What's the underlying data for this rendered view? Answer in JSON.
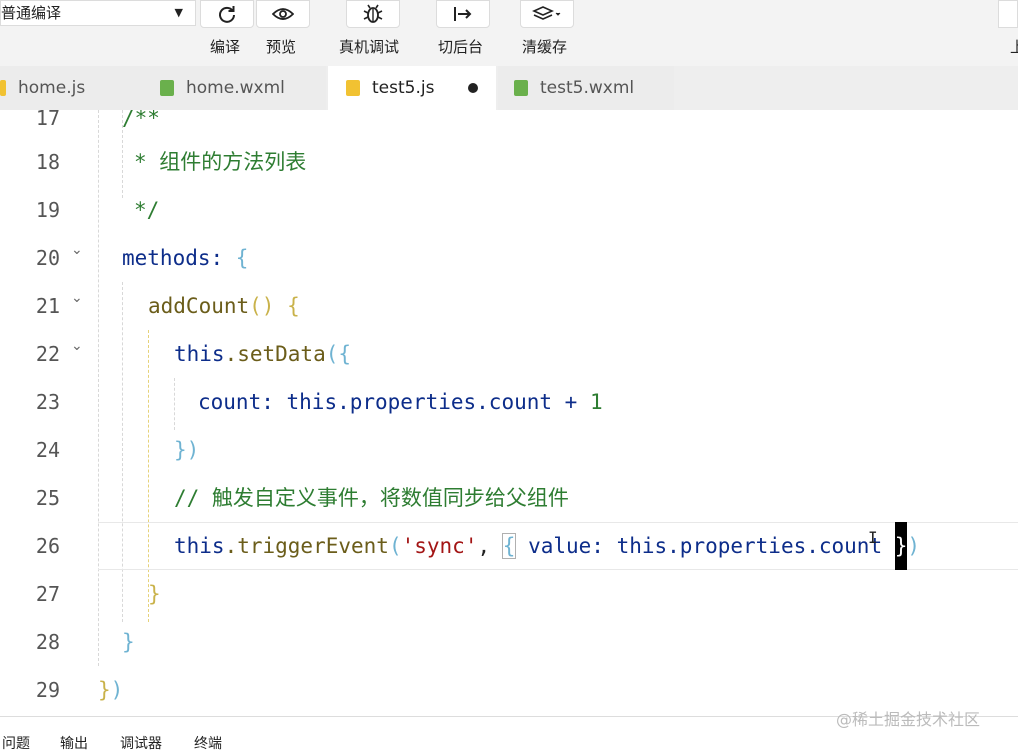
{
  "toolbar": {
    "mode_select": "普通编译",
    "buttons": [
      {
        "icon": "refresh-icon",
        "label": "编译"
      },
      {
        "icon": "eye-icon",
        "label": "预览"
      },
      {
        "icon": "bug-icon",
        "label": "真机调试"
      },
      {
        "icon": "switch-backend-icon",
        "label": "切后台"
      },
      {
        "icon": "layers-icon",
        "label": "清缓存"
      }
    ],
    "right_label": "上"
  },
  "tabs": [
    {
      "name": "home.js",
      "type": "js",
      "active": false
    },
    {
      "name": "home.wxml",
      "type": "wxml",
      "active": false
    },
    {
      "name": "test5.js",
      "type": "js",
      "active": true,
      "modified": true
    },
    {
      "name": "test5.wxml",
      "type": "wxml",
      "active": false
    }
  ],
  "editor": {
    "line_numbers": [
      "17",
      "18",
      "19",
      "20",
      "21",
      "22",
      "23",
      "24",
      "25",
      "26",
      "27",
      "28",
      "29"
    ],
    "code": {
      "l17": "/**",
      "l18": "* 组件的方法列表",
      "l19": "*/",
      "l20_key": "methods: ",
      "l20_brace": "{",
      "l21_fn": "addCount",
      "l21_parens": "()",
      "l21_brace": "{",
      "l22_this": "this",
      "l22_method": ".setData",
      "l22_paren": "(",
      "l22_brace": "{",
      "l23_key": "count: ",
      "l23_this": "this",
      "l23_rest": ".properties.count + ",
      "l23_num": "1",
      "l24_brace": "}",
      "l24_paren": ")",
      "l25_comment": "// 触发自定义事件，将数值同步给父组件",
      "l26_this": "this",
      "l26_method": ".triggerEvent",
      "l26_paren": "(",
      "l26_str": "'sync'",
      "l26_comma": ", ",
      "l26_brace_open": "{",
      "l26_key": " value: ",
      "l26_this2": "this",
      "l26_rest": ".properties.count ",
      "l26_brace_close": "}",
      "l26_paren_close": ")",
      "l27_brace": "}",
      "l28_brace": "}",
      "l29_brace": "}",
      "l29_paren": ")"
    }
  },
  "bottom_panel": {
    "tabs": [
      "问题",
      "输出",
      "调试器",
      "终端"
    ]
  },
  "watermark": "@稀土掘金技术社区"
}
